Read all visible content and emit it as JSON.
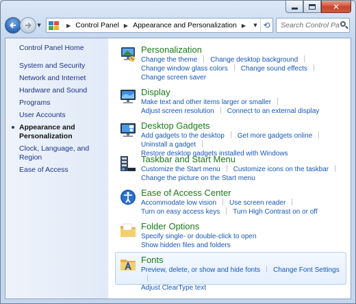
{
  "nav": {
    "breadcrumbs": [
      "Control Panel",
      "Appearance and Personalization"
    ],
    "search_placeholder": "Search Control Panel"
  },
  "sidebar": {
    "items": [
      {
        "label": "Control Panel Home"
      },
      {
        "label": "System and Security"
      },
      {
        "label": "Network and Internet"
      },
      {
        "label": "Hardware and Sound"
      },
      {
        "label": "Programs"
      },
      {
        "label": "User Accounts"
      },
      {
        "label": "Appearance and Personalization",
        "current": true
      },
      {
        "label": "Clock, Language, and Region"
      },
      {
        "label": "Ease of Access"
      }
    ]
  },
  "categories": [
    {
      "title": "Personalization",
      "icon": "personalization-icon",
      "lines": [
        [
          "Change the theme",
          "Change desktop background"
        ],
        [
          "Change window glass colors",
          "Change sound effects"
        ],
        [
          "Change screen saver"
        ]
      ]
    },
    {
      "title": "Display",
      "icon": "display-icon",
      "lines": [
        [
          "Make text and other items larger or smaller"
        ],
        [
          "Adjust screen resolution",
          "Connect to an external display"
        ]
      ]
    },
    {
      "title": "Desktop Gadgets",
      "icon": "gadgets-icon",
      "lines": [
        [
          "Add gadgets to the desktop",
          "Get more gadgets online"
        ],
        [
          "Uninstall a gadget",
          "Restore desktop gadgets installed with Windows"
        ]
      ]
    },
    {
      "title": "Taskbar and Start Menu",
      "icon": "taskbar-icon",
      "lines": [
        [
          "Customize the Start menu",
          "Customize icons on the taskbar"
        ],
        [
          "Change the picture on the Start menu"
        ]
      ]
    },
    {
      "title": "Ease of Access Center",
      "icon": "ease-of-access-icon",
      "lines": [
        [
          "Accommodate low vision",
          "Use screen reader"
        ],
        [
          "Turn on easy access keys",
          "Turn High Contrast on or off"
        ]
      ]
    },
    {
      "title": "Folder Options",
      "icon": "folder-icon",
      "lines": [
        [
          "Specify single- or double-click to open"
        ],
        [
          "Show hidden files and folders"
        ]
      ]
    },
    {
      "title": "Fonts",
      "icon": "fonts-icon",
      "hover": true,
      "lines": [
        [
          "Preview, delete, or show and hide fonts",
          "Change Font Settings"
        ],
        [
          "Adjust ClearType text"
        ]
      ]
    }
  ],
  "colors": {
    "link": "#1656b8",
    "category_title": "#1a7a1a",
    "sidebar_link": "#1e3287"
  }
}
